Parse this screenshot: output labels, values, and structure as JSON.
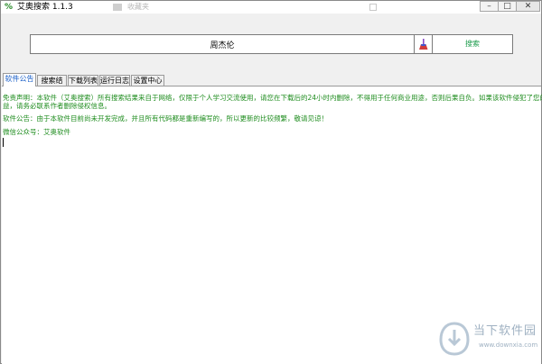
{
  "window": {
    "title": "艾奥搜索 1.1.3",
    "controls": {
      "minimize": "–",
      "maximize": "□",
      "close": "✕"
    }
  },
  "background_window": {
    "text": "收藏夹"
  },
  "search": {
    "value": "周杰伦",
    "button_label": "搜索"
  },
  "tabs": [
    {
      "label": "软件公告",
      "active": true
    },
    {
      "label": "搜索结果",
      "active": false
    },
    {
      "label": "下载列表",
      "active": false
    },
    {
      "label": "运行日志",
      "active": false
    },
    {
      "label": "设置中心",
      "active": false
    }
  ],
  "announcement": {
    "disclaimer_line1": "免责声明：本软件（艾奥搜索）所有搜索结果来自于网络，仅限于个人学习交流使用，请您在下载后的24小时内删除，不得用于任何商业用途，否则后果自负。如果该软件侵犯了您的权",
    "disclaimer_line2": "益，请务必联系作者删除侵权信息。",
    "notice": "软件公告：由于本软件目前尚未开发完成，并且所有代码都是重新编写的，所以更新的比较频繁，敬请见谅！",
    "wechat": "微信公众号：艾奥软件"
  },
  "watermark": {
    "name": "当下软件园",
    "url": "www.downxia.com"
  },
  "colors": {
    "announcement_text": "#1e8c1e",
    "active_tab_text": "#1a5fc8",
    "search_button_text": "#1a9a4a"
  }
}
